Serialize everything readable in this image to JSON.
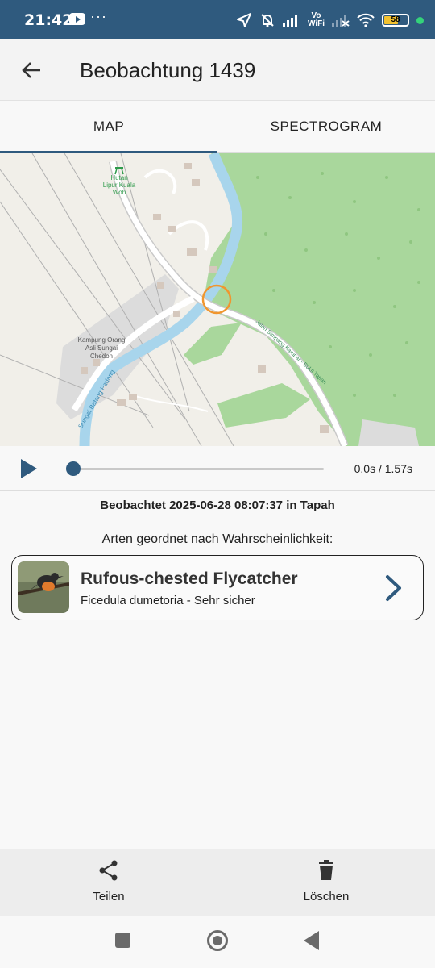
{
  "status_bar": {
    "time": "21:42",
    "more_indicator": "···",
    "vo_wifi": [
      "Vo",
      "WiFi"
    ],
    "battery_level": "58",
    "icons": [
      "youtube-icon",
      "location-arrow-icon",
      "bell-off-icon",
      "signal-icon",
      "vowifi-icon",
      "signal-off-icon",
      "wifi-icon",
      "battery-icon",
      "notification-dot-icon"
    ]
  },
  "app_bar": {
    "title": "Beobachtung 1439",
    "back_icon": "arrow-left-icon"
  },
  "tabs": [
    {
      "label": "MAP",
      "active": true
    },
    {
      "label": "SPECTROGRAM",
      "active": false
    }
  ],
  "map": {
    "labels": {
      "hutan": [
        "Hutan",
        "Lipur Kuala",
        "Woh"
      ],
      "kampung": [
        "Kampung Orang",
        "Asli Sungai",
        "Chedon"
      ],
      "river": "Sungai Batang Padang",
      "road": "Jalan Simpang Kampar - Bukit Tapah"
    },
    "colors": {
      "land": "#f1efe9",
      "forest": "#a9d79c",
      "water": "#a8d5ec",
      "road": "#ffffff",
      "residential": "#dcdcdc",
      "marker": "#f0962f"
    }
  },
  "player": {
    "play_icon": "play-icon",
    "time": "0.0s / 1.57s",
    "progress": 0.0
  },
  "observation": {
    "observed_text": "Beobachtet 2025-06-28 08:07:37 in Tapah",
    "species_heading": "Arten geordnet nach Wahrscheinlichkeit:"
  },
  "species": [
    {
      "common_name": "Rufous-chested Flycatcher",
      "subtitle": "Ficedula dumetoria - Sehr sicher",
      "icon": "chevron-right-icon"
    }
  ],
  "actions": {
    "share_label": "Teilen",
    "delete_label": "Löschen"
  },
  "accent_color": "#2f5a7e"
}
